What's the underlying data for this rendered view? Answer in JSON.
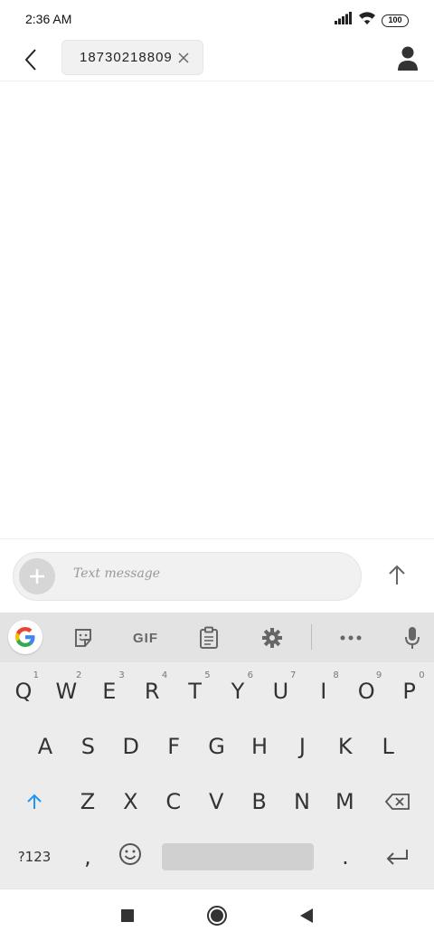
{
  "status_bar": {
    "time": "2:36 AM",
    "battery": "100",
    "icons": [
      "signal-icon",
      "wifi-icon",
      "battery-icon"
    ]
  },
  "top_bar": {
    "recipient": "18730218809",
    "icons": [
      "back-arrow-icon",
      "close-icon",
      "person-icon"
    ]
  },
  "compose": {
    "placeholder": "Text message",
    "icons": [
      "plus-icon",
      "send-arrow-icon"
    ]
  },
  "keyboard": {
    "toolbar": {
      "gif_label": "GIF",
      "icons": [
        "google-icon",
        "sticker-icon",
        "clipboard-icon",
        "gear-icon",
        "more-icon",
        "mic-icon"
      ]
    },
    "row1": [
      "Q",
      "W",
      "E",
      "R",
      "T",
      "Y",
      "U",
      "I",
      "O",
      "P"
    ],
    "row1_hints": [
      "1",
      "2",
      "3",
      "4",
      "5",
      "6",
      "7",
      "8",
      "9",
      "0"
    ],
    "row2": [
      "A",
      "S",
      "D",
      "F",
      "G",
      "H",
      "J",
      "K",
      "L"
    ],
    "row3": [
      "Z",
      "X",
      "C",
      "V",
      "B",
      "N",
      "M"
    ],
    "symbols_label": "?123",
    "comma": ",",
    "period": "."
  },
  "colors": {
    "accent": "#2196f3",
    "toolbar_bg": "#e3e3e3",
    "keyboard_bg": "#ececec"
  }
}
